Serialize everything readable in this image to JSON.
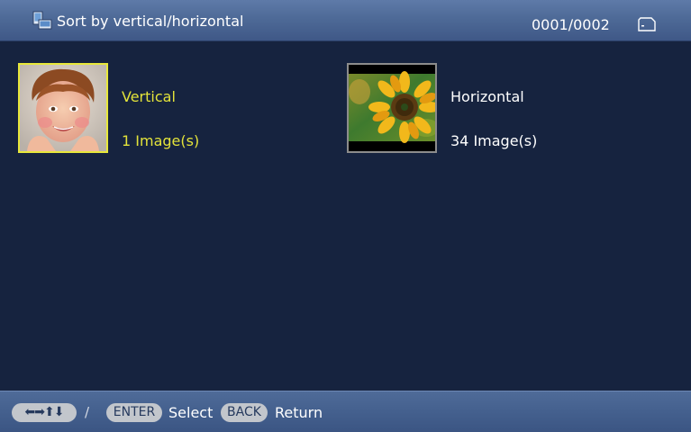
{
  "header": {
    "title": "Sort by vertical∕horizontal",
    "icon": "sort-orientation-icon",
    "page_counter": "0001∕0002",
    "media_icon": "memory-card-icon"
  },
  "groups": [
    {
      "name": "Vertical",
      "count": "1 Image(s)",
      "thumbnail": "boy-portrait",
      "selected": true
    },
    {
      "name": "Horizontal",
      "count": "34 Image(s)",
      "thumbnail": "sunflower",
      "selected": false
    }
  ],
  "footer": {
    "arrows_label": "⬅➡⬆⬇",
    "separator": "/",
    "enter_key": "ENTER",
    "select_label": "Select",
    "back_key": "BACK",
    "return_label": "Return"
  },
  "colors": {
    "background": "#16233f",
    "highlight": "#e3e33a",
    "header_bar": "#4e6a97",
    "pill": "#c2c6cc"
  }
}
